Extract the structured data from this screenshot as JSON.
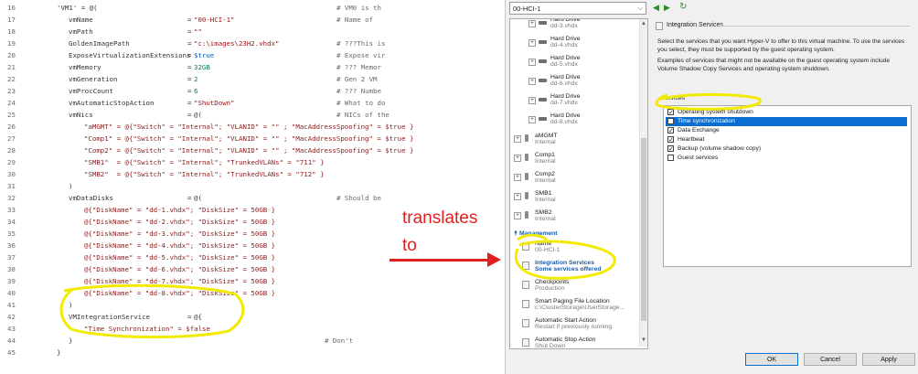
{
  "code_lines": [
    {
      "num": "16",
      "text": "'VM1' = @(",
      "comment": "# VM0 is th"
    },
    {
      "num": "17",
      "key": "vmName",
      "value": "\"00-HCI-1\"",
      "comment": "# Name of"
    },
    {
      "num": "18",
      "key": "vmPath",
      "value": "\"\""
    },
    {
      "num": "19",
      "key": "GoldenImagePath",
      "value": "\"c:\\images\\23H2.vhdx\"",
      "comment": "# ???This is"
    },
    {
      "num": "20",
      "key": "ExposeVirtualizationExtensions",
      "value": "$true",
      "comment": "# Expose vir"
    },
    {
      "num": "21",
      "key": "vmMemory",
      "value": "32GB",
      "comment": "# ??? Memor"
    },
    {
      "num": "22",
      "key": "vmGeneration",
      "value": "2",
      "comment": "# Gen 2 VM"
    },
    {
      "num": "23",
      "key": "vmProcCount",
      "value": "6",
      "comment": "# ??? Numbe"
    },
    {
      "num": "24",
      "key": "vmAutomaticStopAction",
      "value": "\"ShutDown\"",
      "comment": "# What to do"
    },
    {
      "num": "25",
      "key": "vmNics",
      "value": "@(",
      "comment": "# NICs of the"
    },
    {
      "num": "26",
      "text": "\"aMGMT\" = @{\"Switch\" = \"Internal\"; \"VLANID\" = \"\" ; \"MacAddressSpoofing\" = $true }"
    },
    {
      "num": "27",
      "text": "\"Comp1\" = @{\"Switch\" = \"Internal\"; \"VLANID\" = \"\" ; \"MacAddressSpoofing\" = $true }"
    },
    {
      "num": "28",
      "text": "\"Comp2\" = @{\"Switch\" = \"Internal\"; \"VLANID\" = \"\" ; \"MacAddressSpoofing\" = $true }"
    },
    {
      "num": "29",
      "text": "\"SMB1\"  = @{\"Switch\" = \"Internal\"; \"TrunkedVLANs\" = \"711\" }"
    },
    {
      "num": "30",
      "text": "\"SMB2\"  = @{\"Switch\" = \"Internal\"; \"TrunkedVLANs\" = \"712\" }"
    },
    {
      "num": "31",
      "text": ")"
    },
    {
      "num": "32",
      "key": "vmDataDisks",
      "value": "@(",
      "comment": "# Should be"
    },
    {
      "num": "33",
      "text": "@{\"DiskName\" = \"dd-1.vhdx\"; \"DiskSize\" = 50GB }"
    },
    {
      "num": "34",
      "text": "@{\"DiskName\" = \"dd-2.vhdx\"; \"DiskSize\" = 50GB }"
    },
    {
      "num": "35",
      "text": "@{\"DiskName\" = \"dd-3.vhdx\"; \"DiskSize\" = 50GB }"
    },
    {
      "num": "36",
      "text": "@{\"DiskName\" = \"dd-4.vhdx\"; \"DiskSize\" = 50GB }"
    },
    {
      "num": "37",
      "text": "@{\"DiskName\" = \"dd-5.vhdx\"; \"DiskSize\" = 50GB }"
    },
    {
      "num": "38",
      "text": "@{\"DiskName\" = \"dd-6.vhdx\"; \"DiskSize\" = 50GB }"
    },
    {
      "num": "39",
      "text": "@{\"DiskName\" = \"dd-7.vhdx\"; \"DiskSize\" = 50GB }"
    },
    {
      "num": "40",
      "text": "@{\"DiskName\" = \"dd-8.vhdx\"; \"DiskSize\" = 50GB }"
    },
    {
      "num": "41",
      "text": ")"
    },
    {
      "num": "42",
      "key": "VMIntegrationService",
      "value": "@{"
    },
    {
      "num": "43",
      "text": "\"Time Synchronization\" = $false"
    },
    {
      "num": "44",
      "text": "}",
      "comment": "# Don't"
    },
    {
      "num": "45",
      "text": "}"
    }
  ],
  "annotation": {
    "line1": "translates",
    "line2": "to"
  },
  "window": {
    "vm_selector": "00-HCI-1",
    "tree": {
      "hard_drive_label": "Hard Drive",
      "drives": [
        "dd-3.vhdx",
        "dd-4.vhdx",
        "dd-5.vhdx",
        "dd-6.vhdx",
        "dd-7.vhdx",
        "dd-8.vhdx"
      ],
      "first_drive_sub": "dd-3.vhdx",
      "nics": [
        {
          "name": "aMGMT",
          "sub": "Internal"
        },
        {
          "name": "Comp1",
          "sub": "Internal"
        },
        {
          "name": "Comp2",
          "sub": "Internal"
        },
        {
          "name": "SMB1",
          "sub": "Internal"
        },
        {
          "name": "SMB2",
          "sub": "Internal"
        }
      ],
      "management_header": "Management",
      "management": [
        {
          "name": "Name",
          "sub": "00-HCI-1"
        },
        {
          "name": "Integration Services",
          "sub": "Some services offered"
        },
        {
          "name": "Checkpoints",
          "sub": "Production"
        },
        {
          "name": "Smart Paging File Location",
          "sub": "c:\\ClusterStorage\\UserStorage..."
        },
        {
          "name": "Automatic Start Action",
          "sub": "Restart if previously running"
        },
        {
          "name": "Automatic Stop Action",
          "sub": "Shut Down"
        }
      ]
    },
    "panel": {
      "title": "Integration Services",
      "desc1": "Select the services that you want Hyper-V to offer to this virtual machine. To use the services you select, they must be supported by the guest operating system.",
      "desc2": "Examples of services that might not be available on the guest operating system include Volume Shadow Copy Services and operating system shutdown.",
      "services_label": "Services",
      "services": [
        {
          "label": "Operating system shutdown",
          "checked": true
        },
        {
          "label": "Time synchronization",
          "checked": false,
          "selected": true
        },
        {
          "label": "Data Exchange",
          "checked": true
        },
        {
          "label": "Heartbeat",
          "checked": true
        },
        {
          "label": "Backup (volume shadow copy)",
          "checked": true
        },
        {
          "label": "Guest services",
          "checked": false
        }
      ]
    },
    "buttons": {
      "ok": "OK",
      "cancel": "Cancel",
      "apply": "Apply"
    }
  },
  "colors": {
    "highlight": "#f2ea00",
    "annotation": "#e0201e",
    "selection": "#0a6ed1"
  }
}
